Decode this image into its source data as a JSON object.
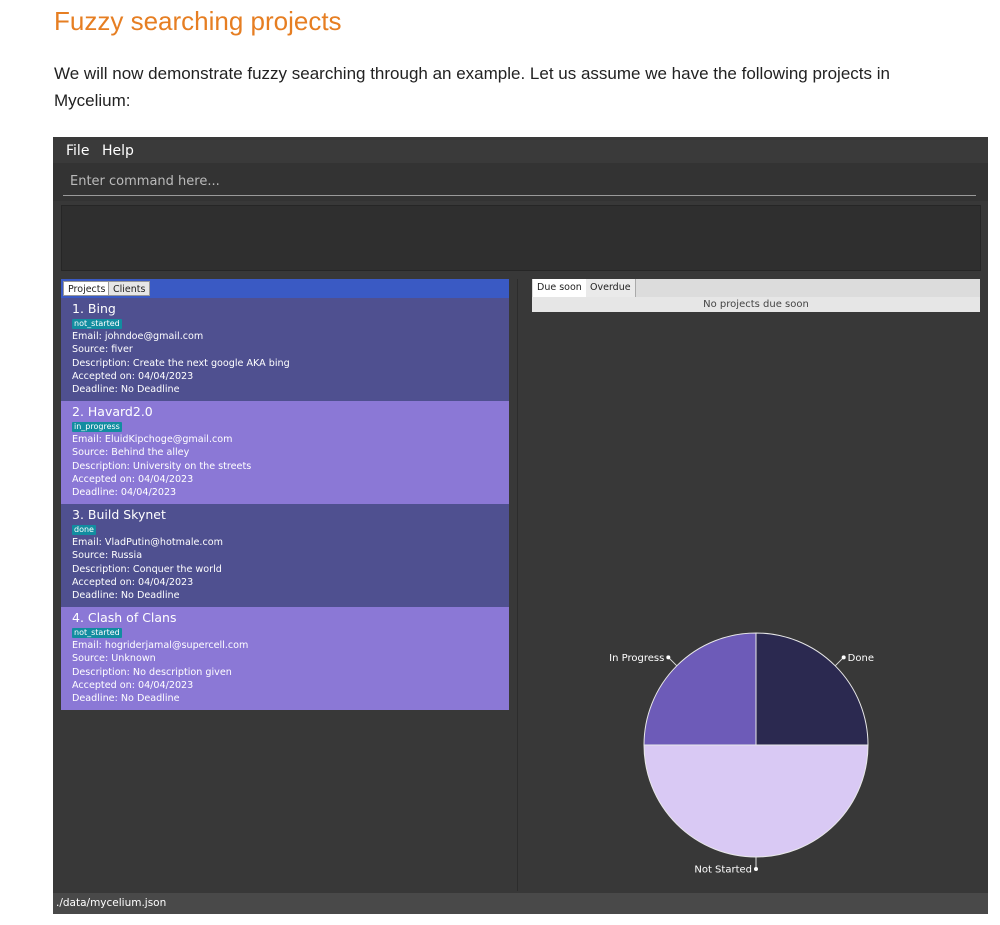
{
  "doc": {
    "title": "Fuzzy searching projects",
    "paragraph": "We will now demonstrate fuzzy searching through an example. Let us assume we have the following projects in Mycelium:"
  },
  "app": {
    "menu": [
      "File",
      "Help"
    ],
    "command_placeholder": "Enter command here...",
    "result_text": "",
    "left_tabs": [
      "Projects",
      "Clients"
    ],
    "active_left_tab": "Projects",
    "projects": [
      {
        "title": "1.  Bing",
        "status": "not_started",
        "email": "Email: johndoe@gmail.com",
        "source": "Source: fiver",
        "description": "Description: Create the next google AKA bing",
        "accepted": "Accepted on: 04/04/2023",
        "deadline": "Deadline: No Deadline"
      },
      {
        "title": "2.  Havard2.0",
        "status": "in_progress",
        "email": "Email: EluidKipchoge@gmail.com",
        "source": "Source: Behind the alley",
        "description": "Description: University on the streets",
        "accepted": "Accepted on: 04/04/2023",
        "deadline": "Deadline: 04/04/2023"
      },
      {
        "title": "3.  Build Skynet",
        "status": "done",
        "email": "Email: VladPutin@hotmale.com",
        "source": "Source: Russia",
        "description": "Description: Conquer the world",
        "accepted": "Accepted on: 04/04/2023",
        "deadline": "Deadline: No Deadline"
      },
      {
        "title": "4.  Clash of Clans",
        "status": "not_started",
        "email": "Email: hogriderjamal@supercell.com",
        "source": "Source: Unknown",
        "description": "Description: No description given",
        "accepted": "Accepted on: 04/04/2023",
        "deadline": "Deadline: No Deadline"
      }
    ],
    "right_tabs": [
      "Due soon",
      "Overdue"
    ],
    "active_right_tab": "Due soon",
    "due_soon_message": "No projects due soon",
    "status_path": "./data/mycelium.json"
  },
  "chart_data": {
    "type": "pie",
    "slices": [
      {
        "label": "Done",
        "value": 1,
        "color": "#2b2950"
      },
      {
        "label": "Not Started",
        "value": 2,
        "color": "#d9c9f4"
      },
      {
        "label": "In Progress",
        "value": 1,
        "color": "#6d5bb8"
      }
    ],
    "start": "top",
    "direction": "clockwise"
  },
  "colors": {
    "doc_title": "#e67e22",
    "tab_bar": "#3a5ac4",
    "card_odd": "#4f5090",
    "card_even": "#8b78d6",
    "badge": "#128da0"
  }
}
